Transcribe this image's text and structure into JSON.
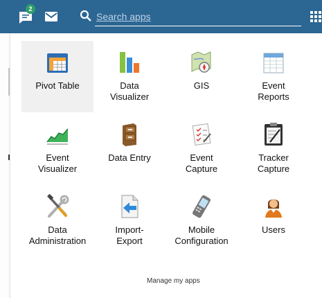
{
  "header": {
    "messages_badge": "2",
    "search_placeholder": "Search apps",
    "icons": [
      "messages-icon",
      "mail-icon",
      "search-icon",
      "apps-grid-icon"
    ]
  },
  "apps": [
    {
      "label": "Pivot Table",
      "icon": "pivot-table-icon"
    },
    {
      "label": "Data\nVisualizer",
      "icon": "data-visualizer-icon"
    },
    {
      "label": "GIS",
      "icon": "gis-icon"
    },
    {
      "label": "Event\nReports",
      "icon": "event-reports-icon"
    },
    {
      "label": "Event\nVisualizer",
      "icon": "event-visualizer-icon"
    },
    {
      "label": "Data Entry",
      "icon": "data-entry-icon"
    },
    {
      "label": "Event\nCapture",
      "icon": "event-capture-icon"
    },
    {
      "label": "Tracker\nCapture",
      "icon": "tracker-capture-icon"
    },
    {
      "label": "Data\nAdministration",
      "icon": "data-administration-icon"
    },
    {
      "label": "Import-\nExport",
      "icon": "import-export-icon"
    },
    {
      "label": "Mobile\nConfiguration",
      "icon": "mobile-configuration-icon"
    },
    {
      "label": "Users",
      "icon": "users-icon"
    }
  ],
  "footer": {
    "manage_label": "Manage my apps"
  },
  "colors": {
    "header_bg": "#2c6693",
    "badge": "#2e9e6a",
    "selected_bg": "#f0f0f0"
  }
}
